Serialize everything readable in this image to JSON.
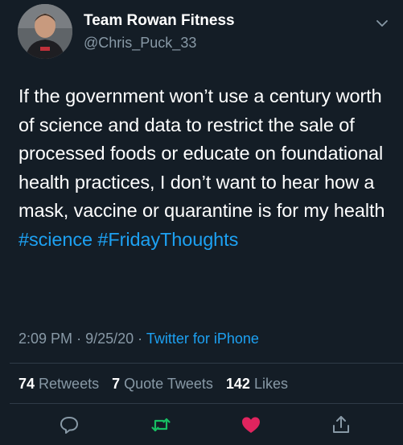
{
  "author": {
    "display_name": "Team Rowan Fitness",
    "handle": "@Chris_Puck_33"
  },
  "tweet": {
    "text_before_tags": "If the government won’t use a century worth of science and data to restrict the sale of processed foods or educate on foundational health practices, I don’t want to hear how a mask, vaccine or quarantine is for my health ",
    "hashtags": [
      "#science",
      "#FridayThoughts"
    ],
    "time": "2:09 PM",
    "date": "9/25/20",
    "source": "Twitter for iPhone"
  },
  "stats": {
    "retweets_count": "74",
    "retweets_label": "Retweets",
    "quote_count": "7",
    "quote_label": "Quote Tweets",
    "likes_count": "142",
    "likes_label": "Likes"
  },
  "icons": {
    "reply": "reply-icon",
    "retweet": "retweet-icon",
    "like": "heart-icon",
    "share": "share-icon",
    "caret": "chevron-down-icon"
  },
  "colors": {
    "background": "#141d26",
    "link": "#1da1f2",
    "secondary_text": "#8899a6",
    "retweet_green": "#17bf63",
    "like_red": "#e0245e"
  }
}
